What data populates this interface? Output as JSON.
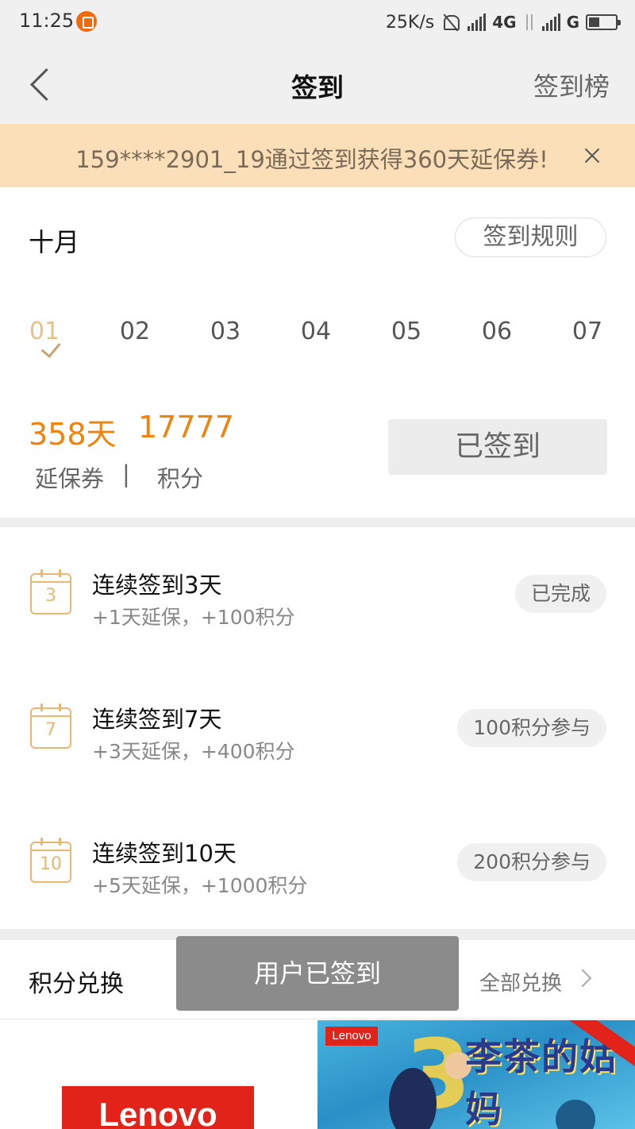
{
  "status_bar": {
    "time": "11:25",
    "net_speed": "25K/s",
    "network_1": "4G",
    "network_2": "G"
  },
  "nav": {
    "title": "签到",
    "right_label": "签到榜"
  },
  "notice": {
    "text": "159****2901_19通过签到获得360天延保券!"
  },
  "calendar": {
    "month": "十月",
    "rules_label": "签到规则",
    "days": [
      "01",
      "02",
      "03",
      "04",
      "05",
      "06",
      "07"
    ],
    "checked_day": "01"
  },
  "stats": {
    "days": "358天",
    "points": "17777",
    "days_label": "延保券",
    "divider": "|",
    "points_label": "积分",
    "signed_button": "已签到"
  },
  "tasks": [
    {
      "icon_num": "3",
      "title": "连续签到3天",
      "reward": "+1天延保，+100积分",
      "badge": "已完成"
    },
    {
      "icon_num": "7",
      "title": "连续签到7天",
      "reward": "+3天延保，+400积分",
      "badge": "100积分参与"
    },
    {
      "icon_num": "10",
      "title": "连续签到10天",
      "reward": "+5天延保，+1000积分",
      "badge": "200积分参与"
    }
  ],
  "exchange": {
    "title": "积分兑换",
    "all_label": "全部兑换"
  },
  "toast": {
    "text": "用户已签到"
  },
  "products": {
    "left_logo": "Lenovo",
    "banner_brand": "Lenovo",
    "banner_title": "李茶的姑妈"
  },
  "colors": {
    "accent": "#f0830c",
    "notice_bg": "#fbdfb8",
    "icon": "#e8b873"
  }
}
